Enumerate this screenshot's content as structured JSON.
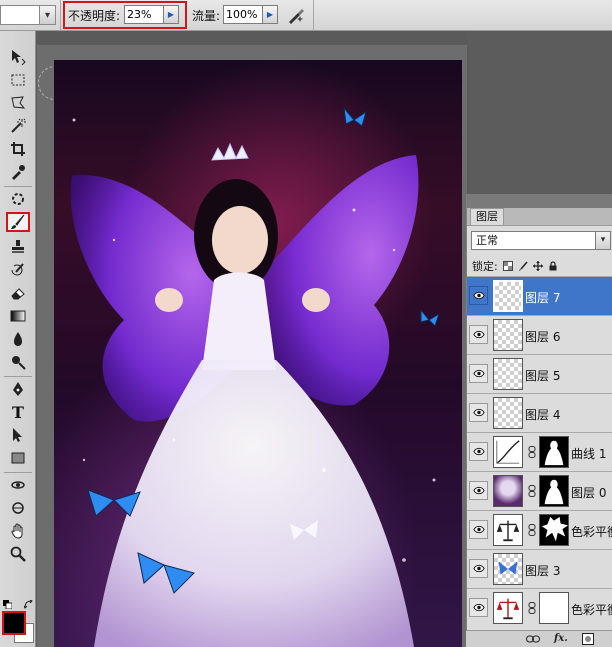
{
  "options_bar": {
    "opacity_label": "不透明度:",
    "opacity_value": "23%",
    "flow_label": "流量:",
    "flow_value": "100%",
    "airbrush_icon": "airbrush-icon"
  },
  "toolbox": {
    "selected_tool": "brush-tool",
    "tools": [
      "move-tool",
      "marquee-tool",
      "lasso-tool",
      "magic-wand-tool",
      "crop-tool",
      "eyedropper-tool",
      "healing-brush-tool",
      "brush-tool",
      "clone-stamp-tool",
      "history-brush-tool",
      "eraser-tool",
      "gradient-tool",
      "blur-tool",
      "dodge-tool",
      "pen-tool",
      "type-tool",
      "path-selection-tool",
      "rectangle-tool",
      "3d-rotate-tool",
      "3d-orbit-tool",
      "hand-tool",
      "zoom-tool"
    ],
    "type_glyph": "T",
    "foreground_color": "#000000",
    "background_color": "#ffffff"
  },
  "layers_panel": {
    "tab_label": "图层",
    "blend_mode": "正常",
    "lock_label": "锁定:",
    "layers": [
      {
        "name": "图层 7",
        "active": true
      },
      {
        "name": "图层 6",
        "active": false
      },
      {
        "name": "图层 5",
        "active": false
      },
      {
        "name": "图层 4",
        "active": false
      },
      {
        "name": "曲线 1",
        "active": false
      },
      {
        "name": "图层 0",
        "active": false
      },
      {
        "name": "色彩平衡",
        "active": false
      },
      {
        "name": "图层 3",
        "active": false
      },
      {
        "name": "色彩平衡",
        "active": false
      }
    ],
    "bottom_fx_label": "fx."
  },
  "colors": {
    "highlight_red": "#d01616",
    "active_layer_blue": "#3f76c9"
  }
}
